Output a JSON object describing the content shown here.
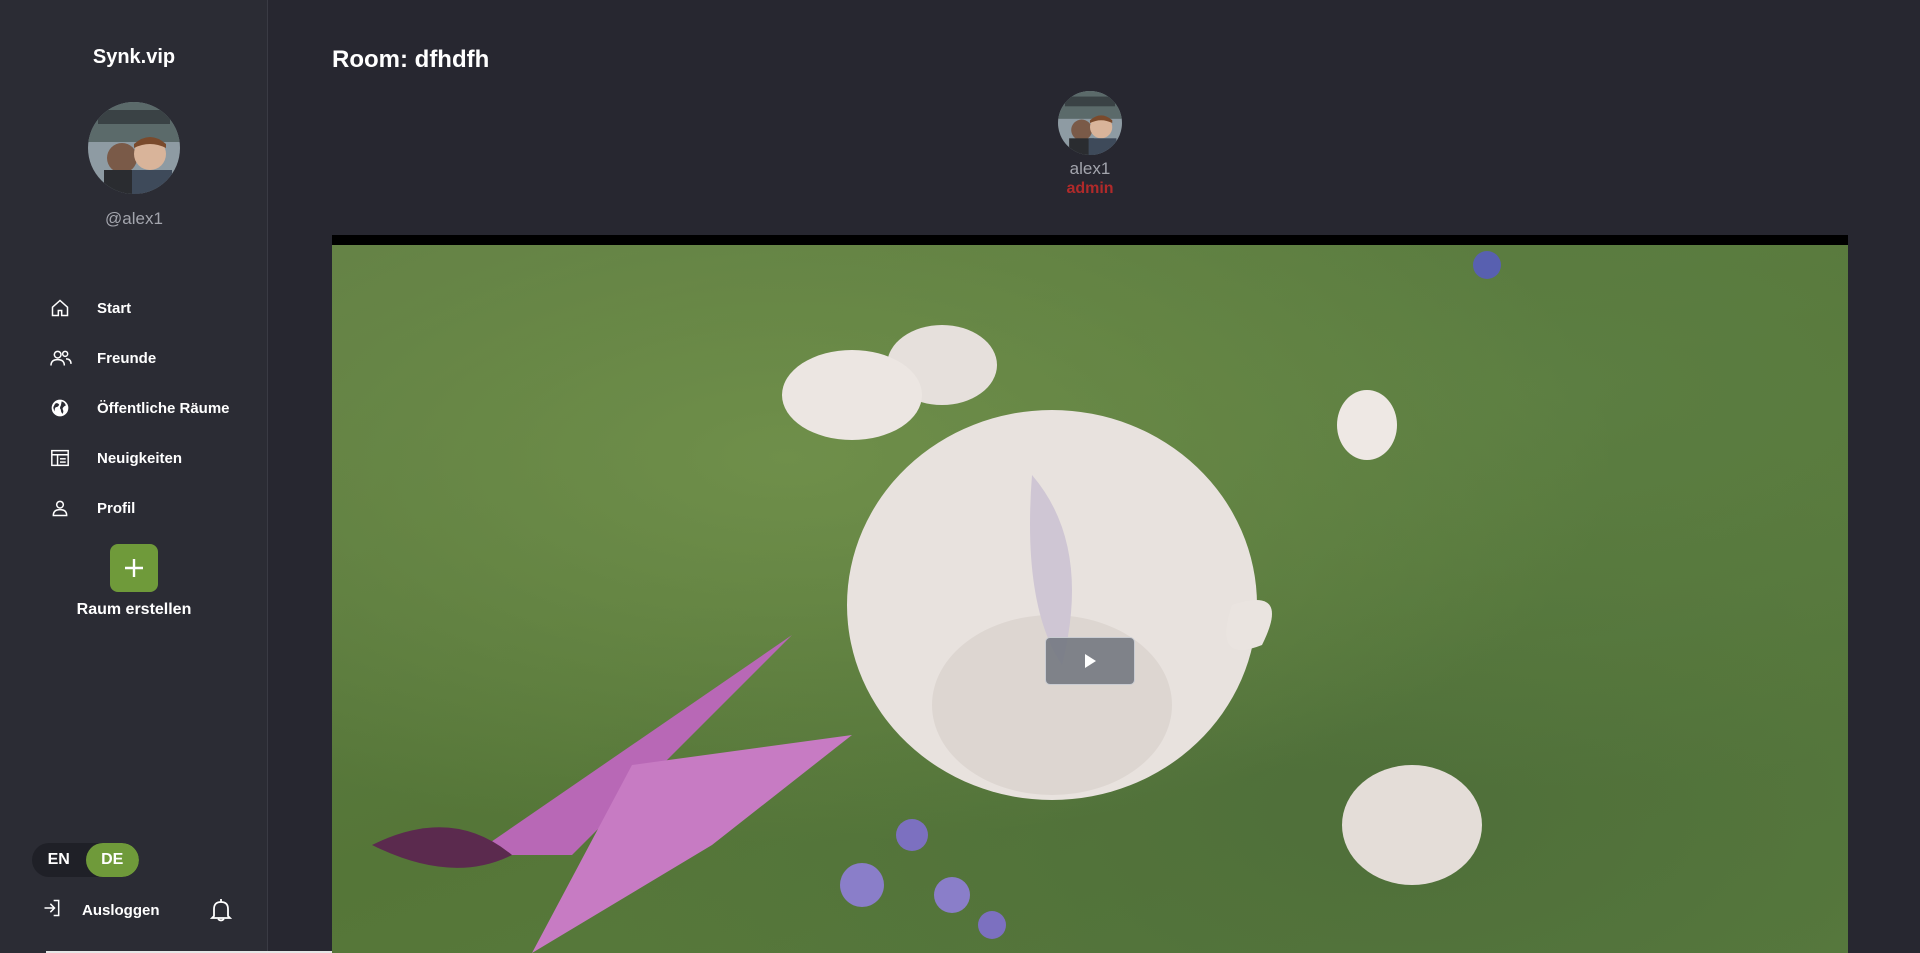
{
  "sidebar": {
    "brand": "Synk.vip",
    "handle": "@alex1",
    "items": [
      {
        "label": "Start",
        "icon": "home-icon"
      },
      {
        "label": "Freunde",
        "icon": "friends-icon"
      },
      {
        "label": "Öffentliche Räume",
        "icon": "globe-icon"
      },
      {
        "label": "Neuigkeiten",
        "icon": "news-icon"
      },
      {
        "label": "Profil",
        "icon": "profile-icon"
      }
    ],
    "create_label": "Raum erstellen",
    "lang": {
      "en": "EN",
      "de": "DE",
      "active": "DE"
    },
    "logout_label": "Ausloggen"
  },
  "main": {
    "room_title": "Room: dfhdfh",
    "member": {
      "name": "alex1",
      "role": "admin"
    }
  },
  "colors": {
    "accent": "#6f9a3a",
    "admin": "#b02a2a",
    "sidebar_bg": "#2b2c34",
    "main_bg": "#272730"
  }
}
